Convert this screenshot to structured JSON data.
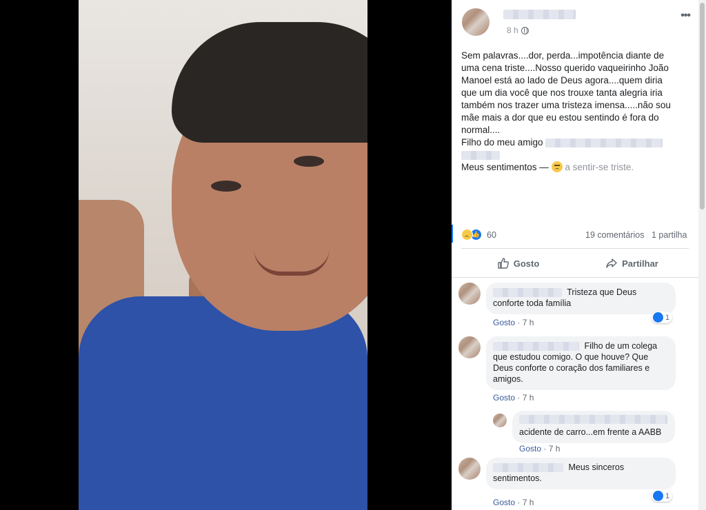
{
  "post": {
    "time": "8 h",
    "text_lines": [
      "Sem palavras....dor, perda...impotência diante de",
      "uma cena triste....Nosso querido vaqueirinho João",
      "Manoel está ao lado de Deus agora....quem diria",
      "que um dia você que nos trouxe tanta alegria iria",
      "também nos trazer uma tristeza imensa.....não sou",
      "mãe mais a dor que eu estou sentindo é fora do",
      "normal...."
    ],
    "friend_prefix": "Filho do meu amigo",
    "feeling_prefix": "Meus sentimentos —",
    "feeling_text": "a sentir-se triste."
  },
  "stats": {
    "reactions": "60",
    "comments": "19 comentários",
    "shares": "1 partilha"
  },
  "actions": {
    "like_label": "Gosto",
    "share_label": "Partilhar"
  },
  "comments": [
    {
      "text_line1": "Tristeza que Deus",
      "text_rest": "conforte toda família",
      "like_link": "Gosto",
      "time": "7 h",
      "likes": "1"
    },
    {
      "text_line1": "Filho de um colega",
      "text_rest_lines": [
        "que estudou comigo. O que houve? Que",
        "Deus conforte o coração dos familiares e",
        "amigos."
      ],
      "like_link": "Gosto",
      "time": "7 h"
    },
    {
      "text": "acidente de carro...em frente a AABB",
      "like_link": "Gosto",
      "time": "7 h"
    },
    {
      "text_line1": "Meus sinceros",
      "text_rest": "sentimentos.",
      "like_link": "Gosto",
      "time": "7 h",
      "likes": "1"
    }
  ],
  "icons": {
    "more": "more-icon",
    "globe": "globe-icon",
    "like": "thumbs-up-icon",
    "share": "share-arrow-icon",
    "sad": "sad-reaction-icon"
  },
  "colors": {
    "accent": "#1877f2",
    "link": "#385898",
    "bubble": "#f2f3f5"
  }
}
